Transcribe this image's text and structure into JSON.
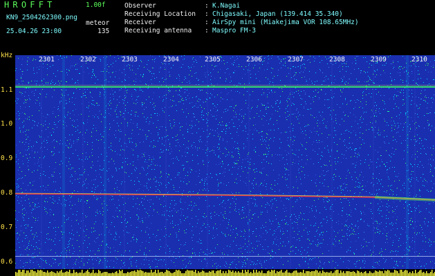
{
  "header": {
    "app_title": "HROFFT",
    "version": "1.00f",
    "filename": "KN9_2504262300.png",
    "datetime": "25.04.26 23:00",
    "meteor_label": "meteor",
    "meteor_count": "135",
    "info": [
      {
        "key": "Observer",
        "value": "K.Nagai"
      },
      {
        "key": "Receiving Location",
        "value": "Chigasaki, Japan (139.414 35.340)"
      },
      {
        "key": "Receiver",
        "value": "AirSpy mini (Miakejima VOR 108.65MHz)"
      },
      {
        "key": "Receiving antenna",
        "value": "Maspro FM-3"
      }
    ],
    "separator": ":"
  },
  "axis": {
    "y_unit": "kHz",
    "y_ticks": [
      "1.1",
      "1.0",
      "0.9",
      "0.8",
      "0.7",
      "0.6"
    ],
    "x_ticks": [
      "2301",
      "2302",
      "2303",
      "2304",
      "2305",
      "2306",
      "2307",
      "2308",
      "2309",
      "2310"
    ]
  },
  "colors": {
    "background_blue": "#1a2fb0",
    "noise_cyan": "#00d8ff",
    "noise_green": "#40ff60",
    "noise_yellow": "#ffff40",
    "signal_red": "#ff3040",
    "label_yellow": "#ffe24a",
    "text_green": "#5cff5c",
    "text_cyan": "#7ffcff"
  }
}
